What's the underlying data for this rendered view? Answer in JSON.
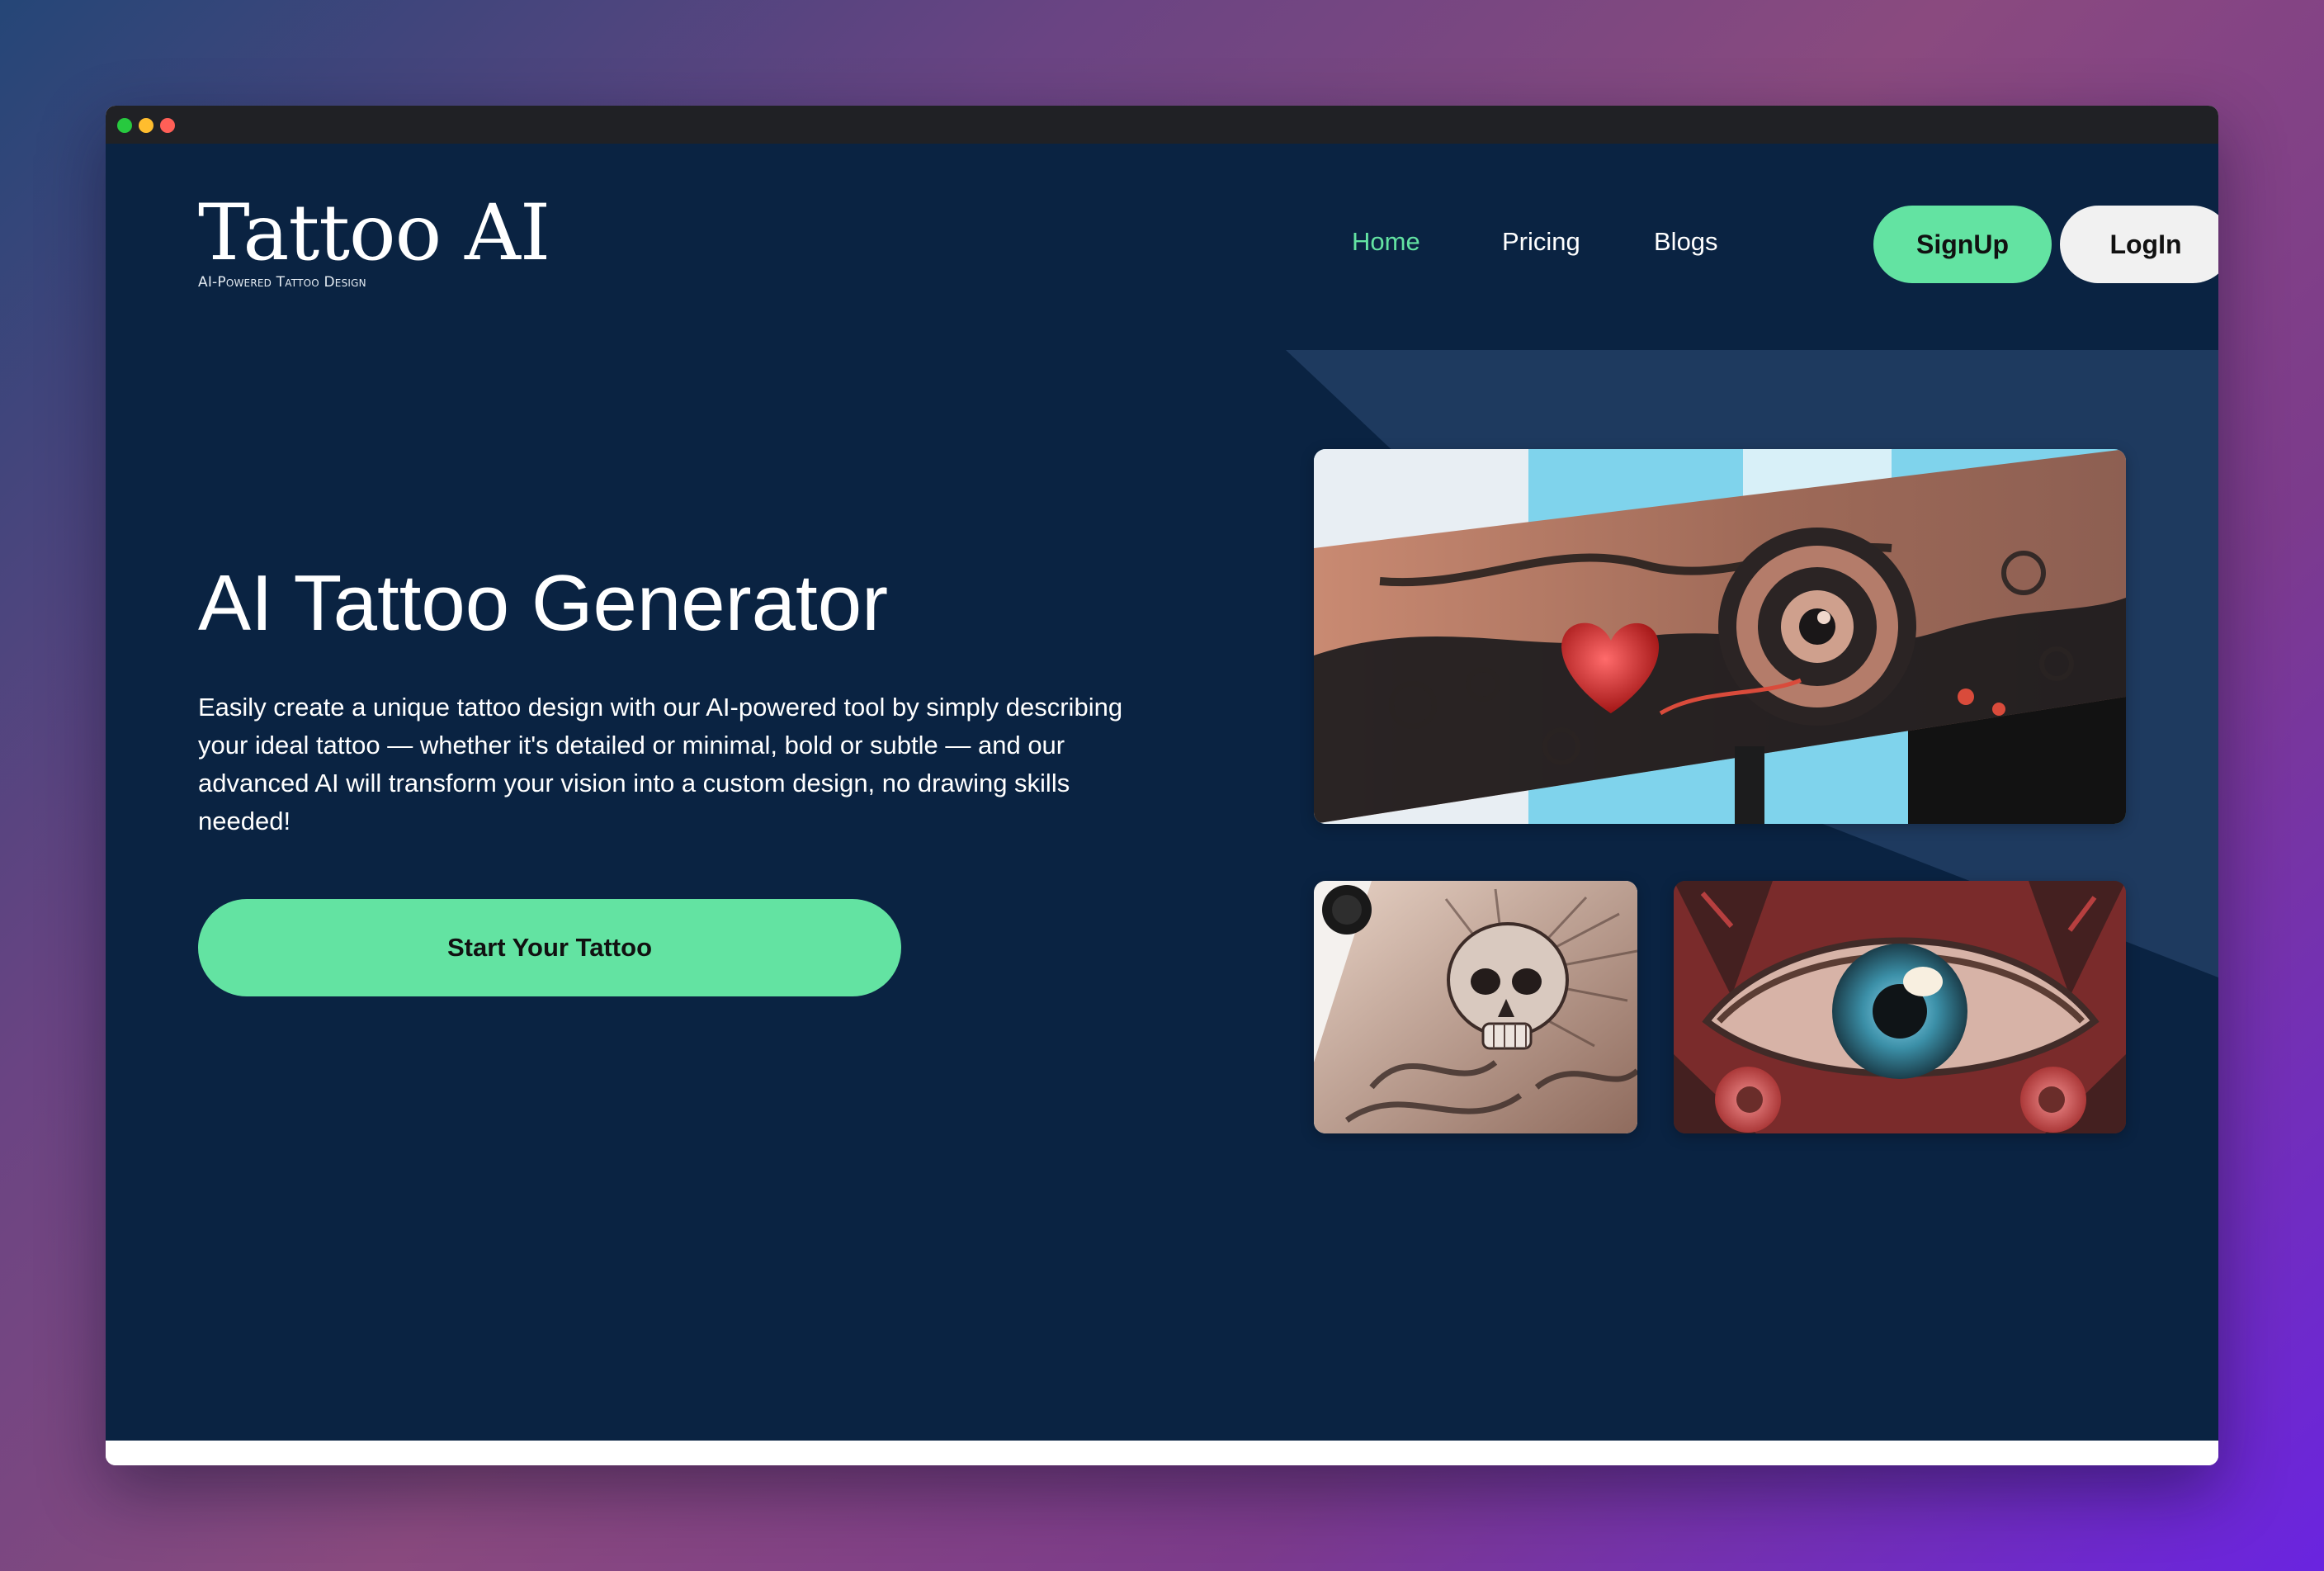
{
  "window": {
    "titlebar_icons": [
      "green-dot",
      "yellow-dot",
      "red-dot"
    ]
  },
  "logo": {
    "title": "Tattoo AI",
    "subtitle": "AI-Powered Tattoo Design"
  },
  "nav": {
    "home": "Home",
    "pricing": "Pricing",
    "blogs": "Blogs",
    "signup": "SignUp",
    "login": "LogIn"
  },
  "hero": {
    "title": "AI Tattoo Generator",
    "description": "Easily create a unique tattoo design with our AI-powered tool by simply describing your ideal tattoo — whether it's detailed or minimal, bold or subtle — and our advanced AI will transform your vision into a custom design, no drawing skills needed!",
    "cta": "Start Your Tattoo"
  },
  "colors": {
    "accent": "#63e3a2",
    "page_background": "#0a2342",
    "shape_background": "#1e3a5f",
    "login_background": "#f1f1f1"
  },
  "images": [
    {
      "name": "tattoo-sleeve-image"
    },
    {
      "name": "skull-tattoo-image"
    },
    {
      "name": "eye-tattoo-image"
    }
  ]
}
